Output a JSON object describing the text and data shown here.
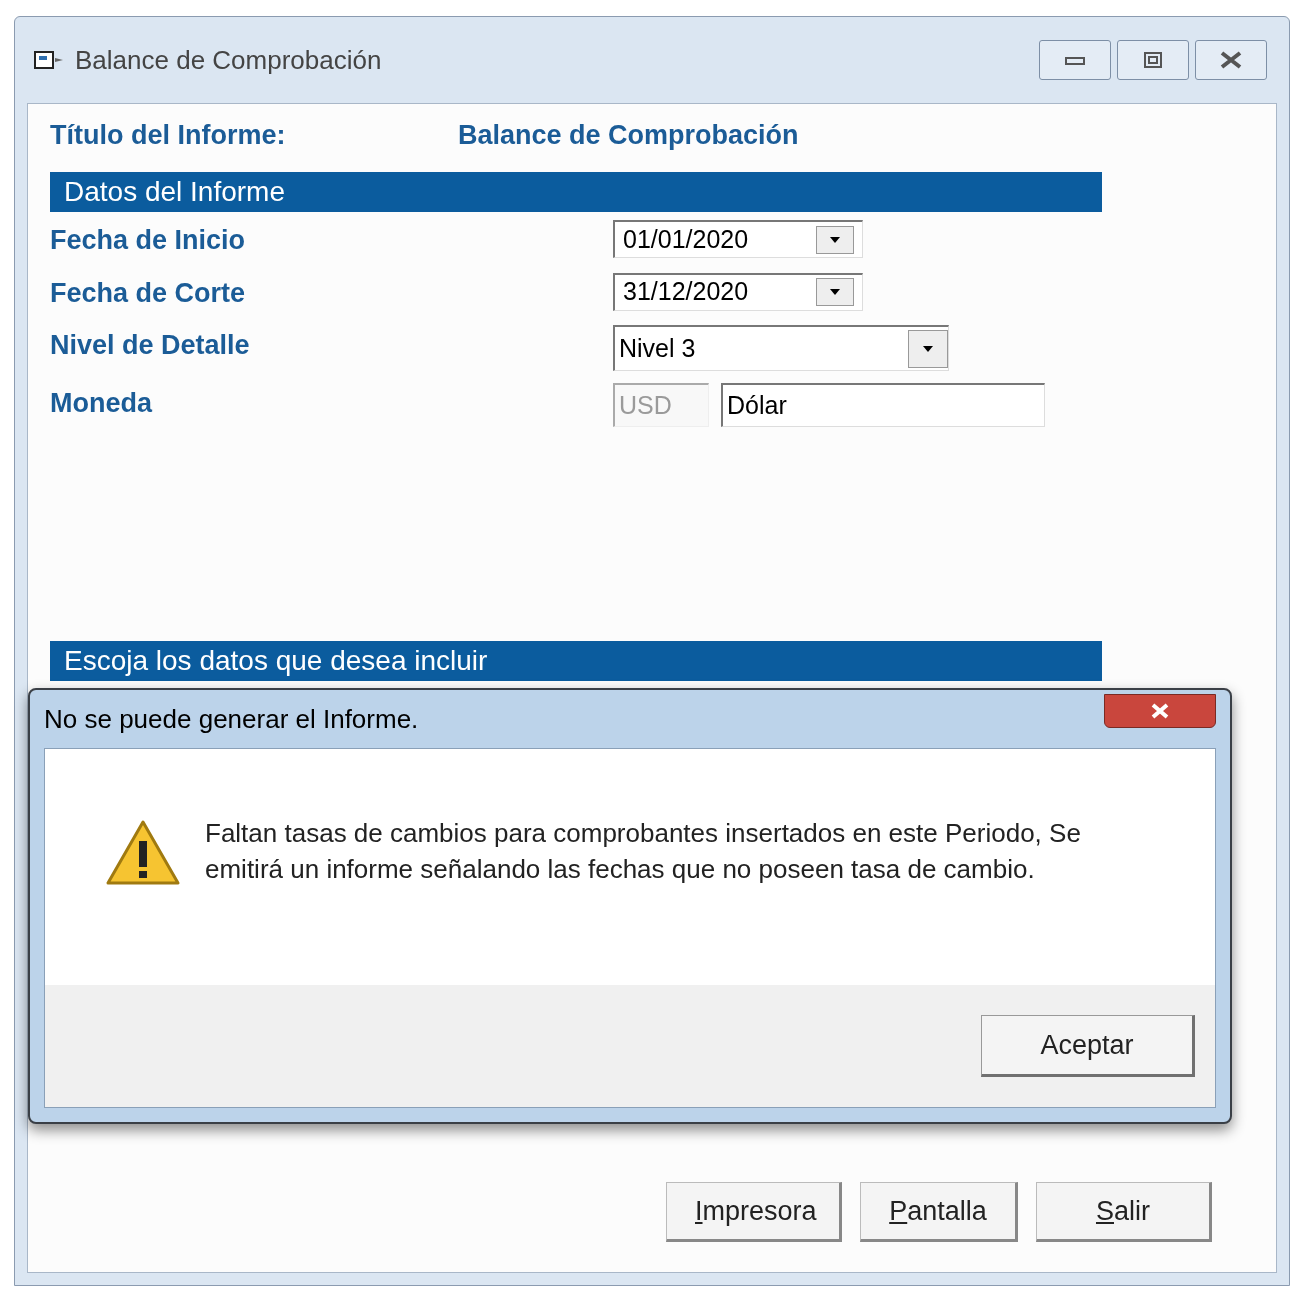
{
  "window": {
    "title": "Balance de Comprobación"
  },
  "report_title": {
    "label": "Título del Informe:",
    "value": "Balance de Comprobación"
  },
  "sections": [
    {
      "title": "Datos del Informe"
    },
    {
      "title": "Escoja los datos que desea incluir"
    }
  ],
  "fields": [
    {
      "kind": "date",
      "label": "Fecha de Inicio",
      "value": "01/01/2020"
    },
    {
      "kind": "date",
      "label": "Fecha de Corte",
      "value": "31/12/2020"
    },
    {
      "kind": "select",
      "label": "Nivel de Detalle",
      "value": "Nivel 3"
    },
    {
      "kind": "currency",
      "label": "Moneda",
      "code": "USD",
      "code_disabled": true,
      "value": "Dólar"
    }
  ],
  "buttons": [
    {
      "label": "Impresora",
      "underline_first": true
    },
    {
      "label": "Pantalla",
      "underline_first": true
    },
    {
      "label": "Salir",
      "underline_first": true
    }
  ],
  "dialog": {
    "title": "No se puede generar el Informe.",
    "message": "Faltan tasas de cambios para comprobantes insertados en este Periodo, Se emitirá un informe señalando las fechas que no poseen tasa de cambio.",
    "button": "Aceptar"
  }
}
